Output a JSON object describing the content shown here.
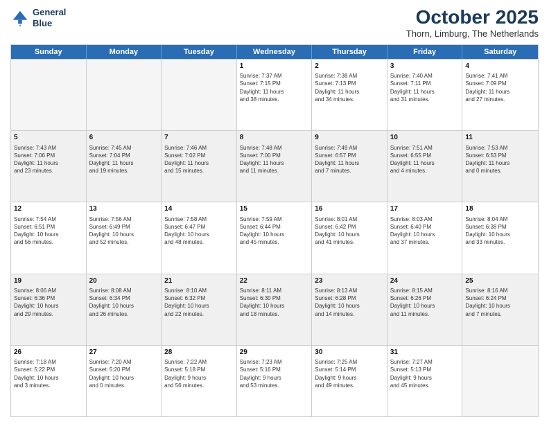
{
  "logo": {
    "line1": "General",
    "line2": "Blue"
  },
  "title": "October 2025",
  "location": "Thorn, Limburg, The Netherlands",
  "header_days": [
    "Sunday",
    "Monday",
    "Tuesday",
    "Wednesday",
    "Thursday",
    "Friday",
    "Saturday"
  ],
  "rows": [
    [
      {
        "day": "",
        "info": "",
        "empty": true
      },
      {
        "day": "",
        "info": "",
        "empty": true
      },
      {
        "day": "",
        "info": "",
        "empty": true
      },
      {
        "day": "1",
        "info": "Sunrise: 7:37 AM\nSunset: 7:15 PM\nDaylight: 11 hours\nand 38 minutes."
      },
      {
        "day": "2",
        "info": "Sunrise: 7:38 AM\nSunset: 7:13 PM\nDaylight: 11 hours\nand 34 minutes."
      },
      {
        "day": "3",
        "info": "Sunrise: 7:40 AM\nSunset: 7:11 PM\nDaylight: 11 hours\nand 31 minutes."
      },
      {
        "day": "4",
        "info": "Sunrise: 7:41 AM\nSunset: 7:09 PM\nDaylight: 11 hours\nand 27 minutes."
      }
    ],
    [
      {
        "day": "5",
        "info": "Sunrise: 7:43 AM\nSunset: 7:06 PM\nDaylight: 11 hours\nand 23 minutes."
      },
      {
        "day": "6",
        "info": "Sunrise: 7:45 AM\nSunset: 7:04 PM\nDaylight: 11 hours\nand 19 minutes."
      },
      {
        "day": "7",
        "info": "Sunrise: 7:46 AM\nSunset: 7:02 PM\nDaylight: 11 hours\nand 15 minutes."
      },
      {
        "day": "8",
        "info": "Sunrise: 7:48 AM\nSunset: 7:00 PM\nDaylight: 11 hours\nand 11 minutes."
      },
      {
        "day": "9",
        "info": "Sunrise: 7:49 AM\nSunset: 6:57 PM\nDaylight: 11 hours\nand 7 minutes."
      },
      {
        "day": "10",
        "info": "Sunrise: 7:51 AM\nSunset: 6:55 PM\nDaylight: 11 hours\nand 4 minutes."
      },
      {
        "day": "11",
        "info": "Sunrise: 7:53 AM\nSunset: 6:53 PM\nDaylight: 11 hours\nand 0 minutes."
      }
    ],
    [
      {
        "day": "12",
        "info": "Sunrise: 7:54 AM\nSunset: 6:51 PM\nDaylight: 10 hours\nand 56 minutes."
      },
      {
        "day": "13",
        "info": "Sunrise: 7:56 AM\nSunset: 6:49 PM\nDaylight: 10 hours\nand 52 minutes."
      },
      {
        "day": "14",
        "info": "Sunrise: 7:58 AM\nSunset: 6:47 PM\nDaylight: 10 hours\nand 48 minutes."
      },
      {
        "day": "15",
        "info": "Sunrise: 7:59 AM\nSunset: 6:44 PM\nDaylight: 10 hours\nand 45 minutes."
      },
      {
        "day": "16",
        "info": "Sunrise: 8:01 AM\nSunset: 6:42 PM\nDaylight: 10 hours\nand 41 minutes."
      },
      {
        "day": "17",
        "info": "Sunrise: 8:03 AM\nSunset: 6:40 PM\nDaylight: 10 hours\nand 37 minutes."
      },
      {
        "day": "18",
        "info": "Sunrise: 8:04 AM\nSunset: 6:38 PM\nDaylight: 10 hours\nand 33 minutes."
      }
    ],
    [
      {
        "day": "19",
        "info": "Sunrise: 8:06 AM\nSunset: 6:36 PM\nDaylight: 10 hours\nand 29 minutes."
      },
      {
        "day": "20",
        "info": "Sunrise: 8:08 AM\nSunset: 6:34 PM\nDaylight: 10 hours\nand 26 minutes."
      },
      {
        "day": "21",
        "info": "Sunrise: 8:10 AM\nSunset: 6:32 PM\nDaylight: 10 hours\nand 22 minutes."
      },
      {
        "day": "22",
        "info": "Sunrise: 8:11 AM\nSunset: 6:30 PM\nDaylight: 10 hours\nand 18 minutes."
      },
      {
        "day": "23",
        "info": "Sunrise: 8:13 AM\nSunset: 6:28 PM\nDaylight: 10 hours\nand 14 minutes."
      },
      {
        "day": "24",
        "info": "Sunrise: 8:15 AM\nSunset: 6:26 PM\nDaylight: 10 hours\nand 11 minutes."
      },
      {
        "day": "25",
        "info": "Sunrise: 8:16 AM\nSunset: 6:24 PM\nDaylight: 10 hours\nand 7 minutes."
      }
    ],
    [
      {
        "day": "26",
        "info": "Sunrise: 7:18 AM\nSunset: 5:22 PM\nDaylight: 10 hours\nand 3 minutes."
      },
      {
        "day": "27",
        "info": "Sunrise: 7:20 AM\nSunset: 5:20 PM\nDaylight: 10 hours\nand 0 minutes."
      },
      {
        "day": "28",
        "info": "Sunrise: 7:22 AM\nSunset: 5:18 PM\nDaylight: 9 hours\nand 56 minutes."
      },
      {
        "day": "29",
        "info": "Sunrise: 7:23 AM\nSunset: 5:16 PM\nDaylight: 9 hours\nand 53 minutes."
      },
      {
        "day": "30",
        "info": "Sunrise: 7:25 AM\nSunset: 5:14 PM\nDaylight: 9 hours\nand 49 minutes."
      },
      {
        "day": "31",
        "info": "Sunrise: 7:27 AM\nSunset: 5:13 PM\nDaylight: 9 hours\nand 45 minutes."
      },
      {
        "day": "",
        "info": "",
        "empty": true
      }
    ]
  ]
}
